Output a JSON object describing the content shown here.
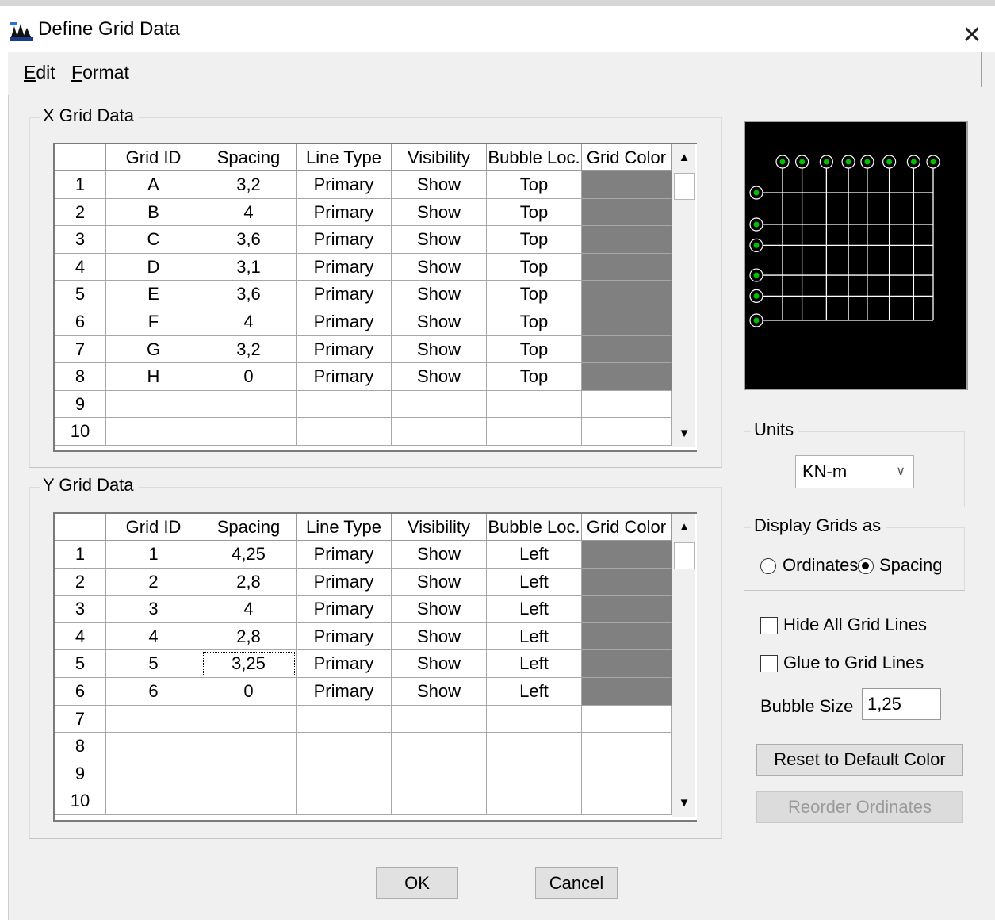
{
  "window": {
    "title": "Define Grid Data",
    "close_glyph": "✕"
  },
  "menu": {
    "items": [
      {
        "key": "E",
        "rest": "dit"
      },
      {
        "key": "F",
        "rest": "ormat"
      }
    ]
  },
  "x_grid": {
    "title": "X Grid Data",
    "columns": [
      "",
      "Grid ID",
      "Spacing",
      "Line Type",
      "Visibility",
      "Bubble Loc.",
      "Grid Color"
    ],
    "row_numbers": [
      "1",
      "2",
      "3",
      "4",
      "5",
      "6",
      "7",
      "8",
      "9",
      "10"
    ],
    "rows": [
      [
        "A",
        "3,2",
        "Primary",
        "Show",
        "Top"
      ],
      [
        "B",
        "4",
        "Primary",
        "Show",
        "Top"
      ],
      [
        "C",
        "3,6",
        "Primary",
        "Show",
        "Top"
      ],
      [
        "D",
        "3,1",
        "Primary",
        "Show",
        "Top"
      ],
      [
        "E",
        "3,6",
        "Primary",
        "Show",
        "Top"
      ],
      [
        "F",
        "4",
        "Primary",
        "Show",
        "Top"
      ],
      [
        "G",
        "3,2",
        "Primary",
        "Show",
        "Top"
      ],
      [
        "H",
        "0",
        "Primary",
        "Show",
        "Top"
      ],
      [
        "",
        "",
        "",
        "",
        ""
      ],
      [
        "",
        "",
        "",
        "",
        ""
      ]
    ],
    "colored_rows": 8
  },
  "y_grid": {
    "title": "Y Grid Data",
    "columns": [
      "",
      "Grid ID",
      "Spacing",
      "Line Type",
      "Visibility",
      "Bubble Loc.",
      "Grid Color"
    ],
    "row_numbers": [
      "1",
      "2",
      "3",
      "4",
      "5",
      "6",
      "7",
      "8",
      "9",
      "10"
    ],
    "rows": [
      [
        "1",
        "4,25",
        "Primary",
        "Show",
        "Left"
      ],
      [
        "2",
        "2,8",
        "Primary",
        "Show",
        "Left"
      ],
      [
        "3",
        "4",
        "Primary",
        "Show",
        "Left"
      ],
      [
        "4",
        "2,8",
        "Primary",
        "Show",
        "Left"
      ],
      [
        "5",
        "3,25",
        "Primary",
        "Show",
        "Left"
      ],
      [
        "6",
        "0",
        "Primary",
        "Show",
        "Left"
      ],
      [
        "",
        "",
        "",
        "",
        ""
      ],
      [
        "",
        "",
        "",
        "",
        ""
      ],
      [
        "",
        "",
        "",
        "",
        ""
      ],
      [
        "",
        "",
        "",
        "",
        ""
      ]
    ],
    "colored_rows": 6,
    "focused_cell": [
      4,
      1
    ]
  },
  "colors": {
    "grid_color": "#808080",
    "preview_lines": "#ffffff",
    "preview_bubbles": "#00c000",
    "preview_bg": "#000000"
  },
  "units": {
    "title": "Units",
    "selected": "KN-m"
  },
  "display": {
    "title": "Display Grids as",
    "ordinates_label": "Ordinates",
    "spacing_label": "Spacing",
    "selected": "Spacing"
  },
  "options": {
    "hide_lines_label": "Hide All Grid Lines",
    "hide_lines_checked": false,
    "glue_label": "Glue to Grid Lines",
    "glue_checked": false
  },
  "bubble": {
    "label": "Bubble Size",
    "value": "1,25"
  },
  "buttons": {
    "reset_color": "Reset to Default Color",
    "reorder": "Reorder Ordinates",
    "ok": "OK",
    "cancel": "Cancel"
  },
  "scroll_icons": {
    "up": "▲",
    "down": "▼",
    "combo": "∨"
  }
}
